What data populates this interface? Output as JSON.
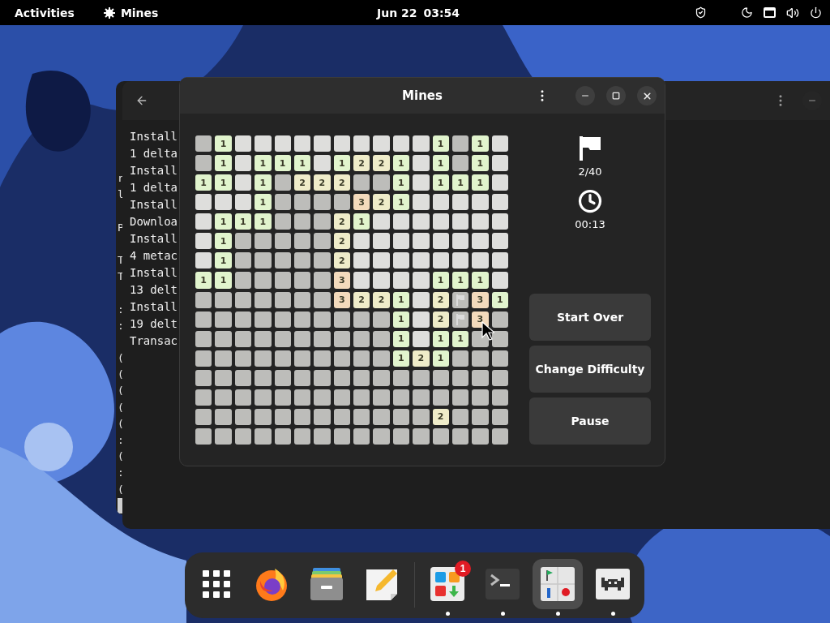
{
  "top_bar": {
    "activities": "Activities",
    "app_menu": "Mines",
    "date": "Jun 22",
    "time": "03:54"
  },
  "back_terminal": {
    "lines": [
      {
        "text": "r"
      },
      {
        "text": "l"
      },
      {
        "kind": "blank"
      },
      {
        "text": "P"
      },
      {
        "kind": "blank"
      },
      {
        "text": "T"
      },
      {
        "text": "T"
      },
      {
        "kind": "blank"
      },
      {
        "text": ":"
      },
      {
        "text": ":"
      },
      {
        "kind": "blank"
      },
      {
        "text": "("
      },
      {
        "text": "("
      },
      {
        "text": "("
      },
      {
        "text": "("
      },
      {
        "text": "("
      },
      {
        "text": ":"
      },
      {
        "text": "("
      },
      {
        "text": ":"
      },
      {
        "text": "("
      },
      {
        "kind": "cursor"
      }
    ]
  },
  "terminal": {
    "lines": [
      "Install",
      "1 delta",
      "Install",
      "1 delta",
      "Install",
      "Downloa",
      "Install",
      "4 metac",
      "Install",
      "13 delt",
      "Install",
      "19 delt",
      "Transac"
    ]
  },
  "mines_window": {
    "title": "Mines",
    "flags": "2/40",
    "elapsed": "00:13",
    "buttons": [
      "Start Over",
      "Change Difficulty",
      "Pause"
    ],
    "grid": {
      "rows": [
        [
          {
            "kind": "covered"
          },
          {
            "kind": "open",
            "number": "1"
          },
          {
            "kind": "open"
          },
          {
            "kind": "open"
          },
          {
            "kind": "open"
          },
          {
            "kind": "open"
          },
          {
            "kind": "open"
          },
          {
            "kind": "open"
          },
          {
            "kind": "open"
          },
          {
            "kind": "open"
          },
          {
            "kind": "open"
          },
          {
            "kind": "open"
          },
          {
            "kind": "open",
            "number": "1"
          },
          {
            "kind": "covered"
          },
          {
            "kind": "open",
            "number": "1"
          },
          {
            "kind": "open"
          }
        ],
        [
          {
            "kind": "covered"
          },
          {
            "kind": "open",
            "number": "1"
          },
          {
            "kind": "open"
          },
          {
            "kind": "open",
            "number": "1"
          },
          {
            "kind": "open",
            "number": "1"
          },
          {
            "kind": "open",
            "number": "1"
          },
          {
            "kind": "open"
          },
          {
            "kind": "open",
            "number": "1"
          },
          {
            "kind": "open",
            "number": "2"
          },
          {
            "kind": "open",
            "number": "2"
          },
          {
            "kind": "open",
            "number": "1"
          },
          {
            "kind": "open"
          },
          {
            "kind": "open",
            "number": "1"
          },
          {
            "kind": "covered"
          },
          {
            "kind": "open",
            "number": "1"
          },
          {
            "kind": "open"
          }
        ],
        [
          {
            "kind": "open",
            "number": "1"
          },
          {
            "kind": "open",
            "number": "1"
          },
          {
            "kind": "open"
          },
          {
            "kind": "open",
            "number": "1"
          },
          {
            "kind": "covered"
          },
          {
            "kind": "open",
            "number": "2"
          },
          {
            "kind": "open",
            "number": "2"
          },
          {
            "kind": "open",
            "number": "2"
          },
          {
            "kind": "covered"
          },
          {
            "kind": "covered"
          },
          {
            "kind": "open",
            "number": "1"
          },
          {
            "kind": "open"
          },
          {
            "kind": "open",
            "number": "1"
          },
          {
            "kind": "open",
            "number": "1"
          },
          {
            "kind": "open",
            "number": "1"
          },
          {
            "kind": "open"
          }
        ],
        [
          {
            "kind": "open"
          },
          {
            "kind": "open"
          },
          {
            "kind": "open"
          },
          {
            "kind": "open",
            "number": "1"
          },
          {
            "kind": "covered"
          },
          {
            "kind": "covered"
          },
          {
            "kind": "covered"
          },
          {
            "kind": "covered"
          },
          {
            "kind": "open",
            "number": "3"
          },
          {
            "kind": "open",
            "number": "2"
          },
          {
            "kind": "open",
            "number": "1"
          },
          {
            "kind": "open"
          },
          {
            "kind": "open"
          },
          {
            "kind": "open"
          },
          {
            "kind": "open"
          },
          {
            "kind": "open"
          }
        ],
        [
          {
            "kind": "open"
          },
          {
            "kind": "open",
            "number": "1"
          },
          {
            "kind": "open",
            "number": "1"
          },
          {
            "kind": "open",
            "number": "1"
          },
          {
            "kind": "covered"
          },
          {
            "kind": "covered"
          },
          {
            "kind": "covered"
          },
          {
            "kind": "open",
            "number": "2"
          },
          {
            "kind": "open",
            "number": "1"
          },
          {
            "kind": "open"
          },
          {
            "kind": "open"
          },
          {
            "kind": "open"
          },
          {
            "kind": "open"
          },
          {
            "kind": "open"
          },
          {
            "kind": "open"
          },
          {
            "kind": "open"
          }
        ],
        [
          {
            "kind": "open"
          },
          {
            "kind": "open",
            "number": "1"
          },
          {
            "kind": "covered"
          },
          {
            "kind": "covered"
          },
          {
            "kind": "covered"
          },
          {
            "kind": "covered"
          },
          {
            "kind": "covered"
          },
          {
            "kind": "open",
            "number": "2"
          },
          {
            "kind": "open"
          },
          {
            "kind": "open"
          },
          {
            "kind": "open"
          },
          {
            "kind": "open"
          },
          {
            "kind": "open"
          },
          {
            "kind": "open"
          },
          {
            "kind": "open"
          },
          {
            "kind": "open"
          }
        ],
        [
          {
            "kind": "open"
          },
          {
            "kind": "open",
            "number": "1"
          },
          {
            "kind": "covered"
          },
          {
            "kind": "covered"
          },
          {
            "kind": "covered"
          },
          {
            "kind": "covered"
          },
          {
            "kind": "covered"
          },
          {
            "kind": "open",
            "number": "2"
          },
          {
            "kind": "open"
          },
          {
            "kind": "open"
          },
          {
            "kind": "open"
          },
          {
            "kind": "open"
          },
          {
            "kind": "open"
          },
          {
            "kind": "open"
          },
          {
            "kind": "open"
          },
          {
            "kind": "open"
          }
        ],
        [
          {
            "kind": "open",
            "number": "1"
          },
          {
            "kind": "open",
            "number": "1"
          },
          {
            "kind": "covered"
          },
          {
            "kind": "covered"
          },
          {
            "kind": "covered"
          },
          {
            "kind": "covered"
          },
          {
            "kind": "covered"
          },
          {
            "kind": "open",
            "number": "3"
          },
          {
            "kind": "open"
          },
          {
            "kind": "open"
          },
          {
            "kind": "open"
          },
          {
            "kind": "open"
          },
          {
            "kind": "open",
            "number": "1"
          },
          {
            "kind": "open",
            "number": "1"
          },
          {
            "kind": "open",
            "number": "1"
          },
          {
            "kind": "open"
          }
        ],
        [
          {
            "kind": "covered"
          },
          {
            "kind": "covered"
          },
          {
            "kind": "covered"
          },
          {
            "kind": "covered"
          },
          {
            "kind": "covered"
          },
          {
            "kind": "covered"
          },
          {
            "kind": "covered"
          },
          {
            "kind": "open",
            "number": "3"
          },
          {
            "kind": "open",
            "number": "2"
          },
          {
            "kind": "open",
            "number": "2"
          },
          {
            "kind": "open",
            "number": "1"
          },
          {
            "kind": "open"
          },
          {
            "kind": "open",
            "number": "2"
          },
          {
            "kind": "flag"
          },
          {
            "kind": "open",
            "number": "3"
          },
          {
            "kind": "open",
            "number": "1"
          }
        ],
        [
          {
            "kind": "covered"
          },
          {
            "kind": "covered"
          },
          {
            "kind": "covered"
          },
          {
            "kind": "covered"
          },
          {
            "kind": "covered"
          },
          {
            "kind": "covered"
          },
          {
            "kind": "covered"
          },
          {
            "kind": "covered"
          },
          {
            "kind": "covered"
          },
          {
            "kind": "covered"
          },
          {
            "kind": "open",
            "number": "1"
          },
          {
            "kind": "open"
          },
          {
            "kind": "open",
            "number": "2"
          },
          {
            "kind": "flag"
          },
          {
            "kind": "open",
            "number": "3"
          },
          {
            "kind": "covered"
          }
        ],
        [
          {
            "kind": "covered"
          },
          {
            "kind": "covered"
          },
          {
            "kind": "covered"
          },
          {
            "kind": "covered"
          },
          {
            "kind": "covered"
          },
          {
            "kind": "covered"
          },
          {
            "kind": "covered"
          },
          {
            "kind": "covered"
          },
          {
            "kind": "covered"
          },
          {
            "kind": "covered"
          },
          {
            "kind": "open",
            "number": "1"
          },
          {
            "kind": "open"
          },
          {
            "kind": "open",
            "number": "1"
          },
          {
            "kind": "open",
            "number": "1"
          },
          {
            "kind": "covered"
          },
          {
            "kind": "covered"
          }
        ],
        [
          {
            "kind": "covered"
          },
          {
            "kind": "covered"
          },
          {
            "kind": "covered"
          },
          {
            "kind": "covered"
          },
          {
            "kind": "covered"
          },
          {
            "kind": "covered"
          },
          {
            "kind": "covered"
          },
          {
            "kind": "covered"
          },
          {
            "kind": "covered"
          },
          {
            "kind": "covered"
          },
          {
            "kind": "open",
            "number": "1"
          },
          {
            "kind": "open",
            "number": "2"
          },
          {
            "kind": "open",
            "number": "1"
          },
          {
            "kind": "covered"
          },
          {
            "kind": "covered"
          },
          {
            "kind": "covered"
          }
        ],
        [
          {
            "kind": "covered"
          },
          {
            "kind": "covered"
          },
          {
            "kind": "covered"
          },
          {
            "kind": "covered"
          },
          {
            "kind": "covered"
          },
          {
            "kind": "covered"
          },
          {
            "kind": "covered"
          },
          {
            "kind": "covered"
          },
          {
            "kind": "covered"
          },
          {
            "kind": "covered"
          },
          {
            "kind": "covered"
          },
          {
            "kind": "covered"
          },
          {
            "kind": "covered"
          },
          {
            "kind": "covered"
          },
          {
            "kind": "covered"
          },
          {
            "kind": "covered"
          }
        ],
        [
          {
            "kind": "covered"
          },
          {
            "kind": "covered"
          },
          {
            "kind": "covered"
          },
          {
            "kind": "covered"
          },
          {
            "kind": "covered"
          },
          {
            "kind": "covered"
          },
          {
            "kind": "covered"
          },
          {
            "kind": "covered"
          },
          {
            "kind": "covered"
          },
          {
            "kind": "covered"
          },
          {
            "kind": "covered"
          },
          {
            "kind": "covered"
          },
          {
            "kind": "covered"
          },
          {
            "kind": "covered"
          },
          {
            "kind": "covered"
          },
          {
            "kind": "covered"
          }
        ],
        [
          {
            "kind": "covered"
          },
          {
            "kind": "covered"
          },
          {
            "kind": "covered"
          },
          {
            "kind": "covered"
          },
          {
            "kind": "covered"
          },
          {
            "kind": "covered"
          },
          {
            "kind": "covered"
          },
          {
            "kind": "covered"
          },
          {
            "kind": "covered"
          },
          {
            "kind": "covered"
          },
          {
            "kind": "covered"
          },
          {
            "kind": "covered"
          },
          {
            "kind": "open",
            "number": "2"
          },
          {
            "kind": "covered"
          },
          {
            "kind": "covered"
          },
          {
            "kind": "covered"
          }
        ],
        [
          {
            "kind": "covered"
          },
          {
            "kind": "covered"
          },
          {
            "kind": "covered"
          },
          {
            "kind": "covered"
          },
          {
            "kind": "covered"
          },
          {
            "kind": "covered"
          },
          {
            "kind": "covered"
          },
          {
            "kind": "covered"
          },
          {
            "kind": "covered"
          },
          {
            "kind": "covered"
          },
          {
            "kind": "covered"
          },
          {
            "kind": "covered"
          },
          {
            "kind": "covered"
          },
          {
            "kind": "covered"
          },
          {
            "kind": "covered"
          },
          {
            "kind": "covered"
          }
        ]
      ]
    }
  },
  "dock": {
    "items": [
      {
        "kind": "app-grid",
        "running": false,
        "selected": false
      },
      {
        "kind": "browser",
        "running": false,
        "selected": false
      },
      {
        "kind": "files",
        "running": false,
        "selected": false
      },
      {
        "kind": "editor",
        "running": false,
        "selected": false
      },
      {
        "kind": "separator"
      },
      {
        "kind": "software",
        "running": true,
        "selected": false,
        "badge": "1"
      },
      {
        "kind": "terminal",
        "running": true,
        "selected": false
      },
      {
        "kind": "mines",
        "running": true,
        "selected": true
      },
      {
        "kind": "game",
        "running": true,
        "selected": false
      }
    ]
  }
}
